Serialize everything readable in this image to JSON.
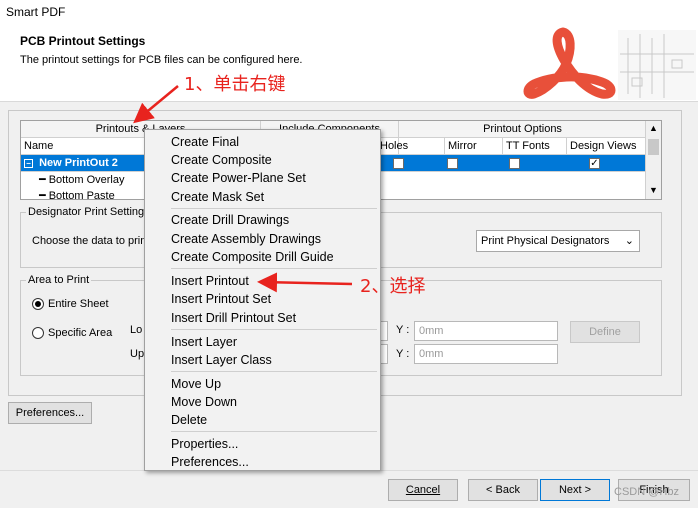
{
  "window": {
    "title": "Smart PDF"
  },
  "header": {
    "title": "PCB Printout Settings",
    "subtitle": "The printout settings for PCB files can be configured here."
  },
  "grid": {
    "headers": {
      "printouts_layers": "Printouts & Layers",
      "include_components": "Include Components",
      "printout_options": "Printout Options"
    },
    "columns": {
      "name": "Name",
      "holes": "Holes",
      "mirror": "Mirror",
      "tt_fonts": "TT Fonts",
      "design_views": "Design Views"
    },
    "rows": [
      {
        "name": "New PrintOut 2",
        "holes": false,
        "mirror": false,
        "tt_fonts": false,
        "design_views": true
      },
      {
        "name": "Bottom Overlay"
      },
      {
        "name": "Bottom Paste"
      }
    ]
  },
  "designator": {
    "legend": "Designator Print Settings",
    "label": "Choose the data to print",
    "select_value": "Print Physical Designators"
  },
  "area": {
    "legend": "Area to Print",
    "entire_sheet": "Entire Sheet",
    "specific_area": "Specific Area",
    "lower_label": "Lo",
    "upper_label": "Up",
    "y_label": "Y :",
    "y1_placeholder": "0mm",
    "y2_placeholder": "0mm",
    "define_button": "Define"
  },
  "preferences_button": "Preferences...",
  "footer": {
    "cancel": "Cancel",
    "back": "< Back",
    "next": "Next >",
    "finish": "Finish",
    "watermark": "CSDN @Hbz"
  },
  "context_menu": {
    "items": [
      "Create Final",
      "Create Composite",
      "Create Power-Plane Set",
      "Create Mask Set",
      "Create Drill Drawings",
      "Create Assembly Drawings",
      "Create Composite Drill Guide",
      "Insert Printout",
      "Insert Printout Set",
      "Insert Drill Printout Set",
      "Insert Layer",
      "Insert Layer Class",
      "Move Up",
      "Move Down",
      "Delete",
      "Properties...",
      "Preferences..."
    ]
  },
  "annotations": {
    "step1": "1、单击右键",
    "step2": "2、选择"
  },
  "colors": {
    "selection": "#0078d7",
    "annotation": "#e8231e",
    "logo": "#e8503a"
  }
}
